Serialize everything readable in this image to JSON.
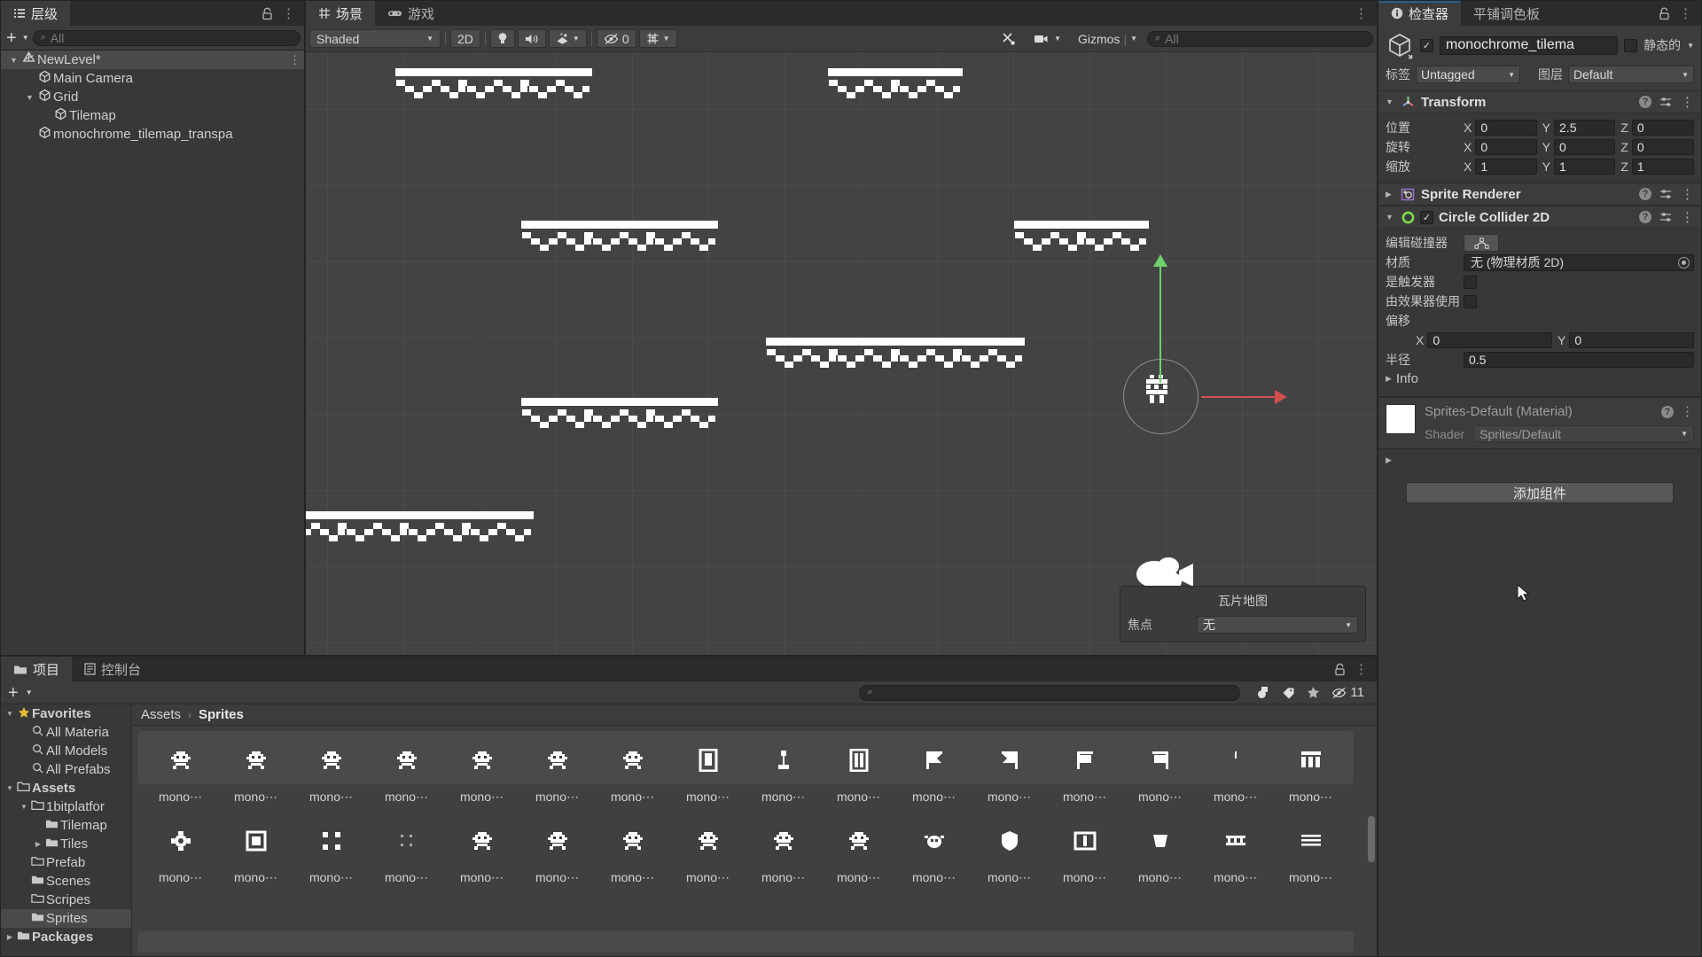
{
  "hierarchy": {
    "tab_label": "层级",
    "tab_icon": "hierarchy-icon",
    "search_placeholder": "All",
    "add_label": "+",
    "lock_icon": "lock-icon",
    "kebab_icon": "kebab-menu-icon",
    "items": [
      {
        "label": "NewLevel*",
        "indent": 0,
        "arrow": "▼",
        "icon": "unity-scene-icon",
        "selected": true,
        "kebab": "⋮"
      },
      {
        "label": "Main Camera",
        "indent": 1,
        "arrow": "",
        "icon": "gameobject-icon",
        "selected": false,
        "kebab": ""
      },
      {
        "label": "Grid",
        "indent": 1,
        "arrow": "▼",
        "icon": "gameobject-icon",
        "selected": false,
        "kebab": ""
      },
      {
        "label": "Tilemap",
        "indent": 2,
        "arrow": "",
        "icon": "gameobject-icon",
        "selected": false,
        "kebab": ""
      },
      {
        "label": "monochrome_tilemap_transpa",
        "indent": 1,
        "arrow": "",
        "icon": "gameobject-icon",
        "selected": false,
        "kebab": ""
      }
    ]
  },
  "scene": {
    "tabs": [
      {
        "label": "场景",
        "icon": "scene-grid-icon",
        "active": true
      },
      {
        "label": "游戏",
        "icon": "gamepad-icon",
        "active": false
      }
    ],
    "kebab_icon": "kebab-menu-icon",
    "toolbar": {
      "shading_mode": "Shaded",
      "mode_2d": "2D",
      "light_icon": "lightbulb-icon",
      "audio_icon": "speaker-icon",
      "fx_icon": "effects-icon",
      "hidden_count": "0",
      "hidden_icon": "eye-off-icon",
      "grid_icon": "grid-snap-icon",
      "tools_icon": "tools-icon",
      "camera_icon": "camera-icon",
      "gizmos_label": "Gizmos",
      "search_placeholder": "All"
    },
    "overlay_popup": {
      "title": "瓦片地图",
      "field_label": "焦点",
      "field_value": "无"
    }
  },
  "inspector": {
    "tabs": [
      {
        "label": "检查器",
        "icon": "info-icon",
        "active": true
      },
      {
        "label": "平铺调色板",
        "icon": "",
        "active": false
      }
    ],
    "lock_icon": "lock-open-icon",
    "kebab_icon": "kebab-menu-icon",
    "object": {
      "name": "monochrome_tilema",
      "enabled": true,
      "static_label": "静态的",
      "tag_label": "标签",
      "tag_value": "Untagged",
      "layer_label": "图层",
      "layer_value": "Default",
      "icon": "gameobject-cube-icon"
    },
    "components": [
      {
        "name": "Transform",
        "icon": "transform-axis-icon",
        "expanded": true,
        "rows": [
          {
            "label": "位置",
            "x": "0",
            "y": "2.5",
            "z": "0"
          },
          {
            "label": "旋转",
            "x": "0",
            "y": "0",
            "z": "0"
          },
          {
            "label": "缩放",
            "x": "1",
            "y": "1",
            "z": "1"
          }
        ]
      },
      {
        "name": "Sprite Renderer",
        "icon": "sprite-renderer-icon",
        "expanded": false,
        "enabled": true
      },
      {
        "name": "Circle Collider 2D",
        "icon": "circle-collider-icon",
        "expanded": true,
        "enabled": true,
        "edit_collider_label": "编辑碰撞器",
        "material_label": "材质",
        "material_value": "无 (物理材质 2D)",
        "is_trigger_label": "是触发器",
        "used_by_effector_label": "由效果器使用",
        "offset_label": "偏移",
        "offset_x": "0",
        "offset_y": "0",
        "radius_label": "半径",
        "radius_value": "0.5",
        "info_label": "Info"
      }
    ],
    "material": {
      "name": "Sprites-Default (Material)",
      "shader_label": "Shader",
      "shader_value": "Sprites/Default",
      "swatch_color": "#ffffff"
    },
    "add_component_label": "添加组件"
  },
  "project": {
    "tabs": [
      {
        "label": "项目",
        "icon": "folder-icon",
        "active": true
      },
      {
        "label": "控制台",
        "icon": "console-icon",
        "active": false
      }
    ],
    "lock_icon": "lock-icon",
    "kebab_icon": "kebab-menu-icon",
    "add_label": "+",
    "search_placeholder": "",
    "hidden_count": "11",
    "hidden_icon": "eye-off-icon",
    "star_icon": "star-icon",
    "label_icon": "tag-icon",
    "type_icon": "asset-type-icon",
    "tree": [
      {
        "label": "Favorites",
        "indent": 0,
        "arrow": "▼",
        "icon": "star",
        "selected": false
      },
      {
        "label": "All Materia",
        "indent": 1,
        "arrow": "",
        "icon": "search",
        "selected": false
      },
      {
        "label": "All Models",
        "indent": 1,
        "arrow": "",
        "icon": "search",
        "selected": false
      },
      {
        "label": "All Prefabs",
        "indent": 1,
        "arrow": "",
        "icon": "search",
        "selected": false
      },
      {
        "label": "Assets",
        "indent": 0,
        "arrow": "▼",
        "icon": "folder-open",
        "selected": false
      },
      {
        "label": "1bitplatfor",
        "indent": 1,
        "arrow": "▼",
        "icon": "folder-open",
        "selected": false
      },
      {
        "label": "Tilemap",
        "indent": 2,
        "arrow": "",
        "icon": "folder",
        "selected": false
      },
      {
        "label": "Tiles",
        "indent": 2,
        "arrow": "▶",
        "icon": "folder",
        "selected": false
      },
      {
        "label": "Prefab",
        "indent": 1,
        "arrow": "",
        "icon": "folder-empty",
        "selected": false
      },
      {
        "label": "Scenes",
        "indent": 1,
        "arrow": "",
        "icon": "folder",
        "selected": false
      },
      {
        "label": "Scripes",
        "indent": 1,
        "arrow": "",
        "icon": "folder-empty",
        "selected": false
      },
      {
        "label": "Sprites",
        "indent": 1,
        "arrow": "",
        "icon": "folder",
        "selected": true
      },
      {
        "label": "Packages",
        "indent": 0,
        "arrow": "▶",
        "icon": "folder",
        "selected": false
      }
    ],
    "breadcrumb": {
      "root": "Assets",
      "separator": "›",
      "current": "Sprites"
    },
    "assets": {
      "label": "mono⋯",
      "row1": [
        "skull",
        "skull",
        "skull",
        "skull",
        "skull",
        "skull",
        "skull",
        "door",
        "lamp",
        "door2",
        "flag",
        "flag2",
        "flag3",
        "flag4",
        "thin",
        "banner"
      ],
      "row2": [
        "gear",
        "box",
        "box2",
        "dots",
        "skull",
        "skull",
        "skull",
        "skull",
        "skull",
        "skull",
        "bug",
        "shield",
        "window",
        "shape",
        "fence",
        "grate"
      ]
    }
  }
}
